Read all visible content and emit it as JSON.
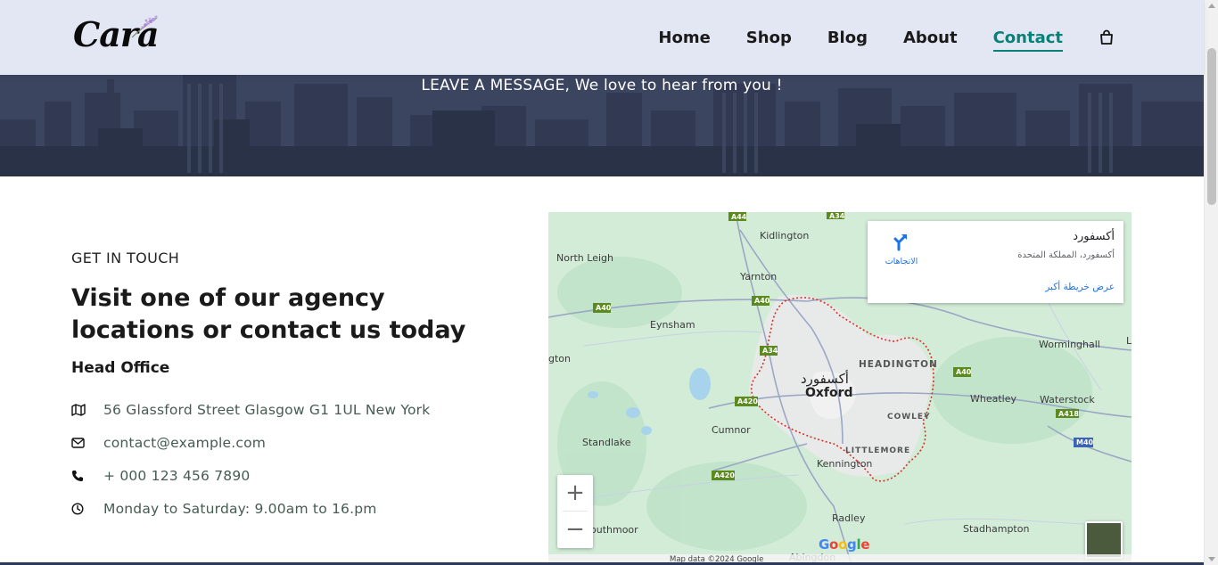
{
  "brand": {
    "logo_text": "Cara"
  },
  "nav": {
    "items": [
      "Home",
      "Shop",
      "Blog",
      "About",
      "Contact"
    ],
    "active": "Contact",
    "accent_color": "#088178",
    "cart_icon": "shopping-bag-icon"
  },
  "hero": {
    "message": "LEAVE A MESSAGE, We love to hear from you !"
  },
  "contact": {
    "eyebrow": "GET IN TOUCH",
    "headline": "Visit one of our agency locations or contact us today",
    "office_heading": "Head Office",
    "items": [
      {
        "icon": "map-icon",
        "text": "56 Glassford Street Glasgow G1 1UL New York"
      },
      {
        "icon": "envelope-icon",
        "text": "contact@example.com"
      },
      {
        "icon": "phone-icon",
        "text": "+ 000 123 456 7890"
      },
      {
        "icon": "clock-icon",
        "text": "Monday to Saturday: 9.00am to 16.pm"
      }
    ]
  },
  "map": {
    "place_title": "أكسفورد",
    "place_subtitle": "أكسفورد، المملكة المتحدة",
    "directions_label": "الاتجاهات",
    "larger_map_link": "عرض خريطة أكبر",
    "city_label_ar": "أكسفورد",
    "city_label_en": "Oxford",
    "place_labels": [
      "Kidlington",
      "North Leigh",
      "Yarnton",
      "Eynsham",
      "HEADINGTON",
      "Worminghall",
      "Wheatley",
      "Waterstock",
      "COWLEY",
      "Cumnor",
      "Standlake",
      "LITTLEMORE",
      "Kennington",
      "Radley",
      "Stadhampton",
      "Abingdon",
      "outhmoor",
      "gton",
      "L"
    ],
    "road_labels": [
      "A44",
      "A34",
      "A40",
      "A34",
      "A420",
      "A420",
      "A40",
      "A418",
      "M40"
    ],
    "zoom_in": "+",
    "zoom_out": "−",
    "google_logo": "Google",
    "footer": [
      "Map data ©2024 Google"
    ]
  }
}
